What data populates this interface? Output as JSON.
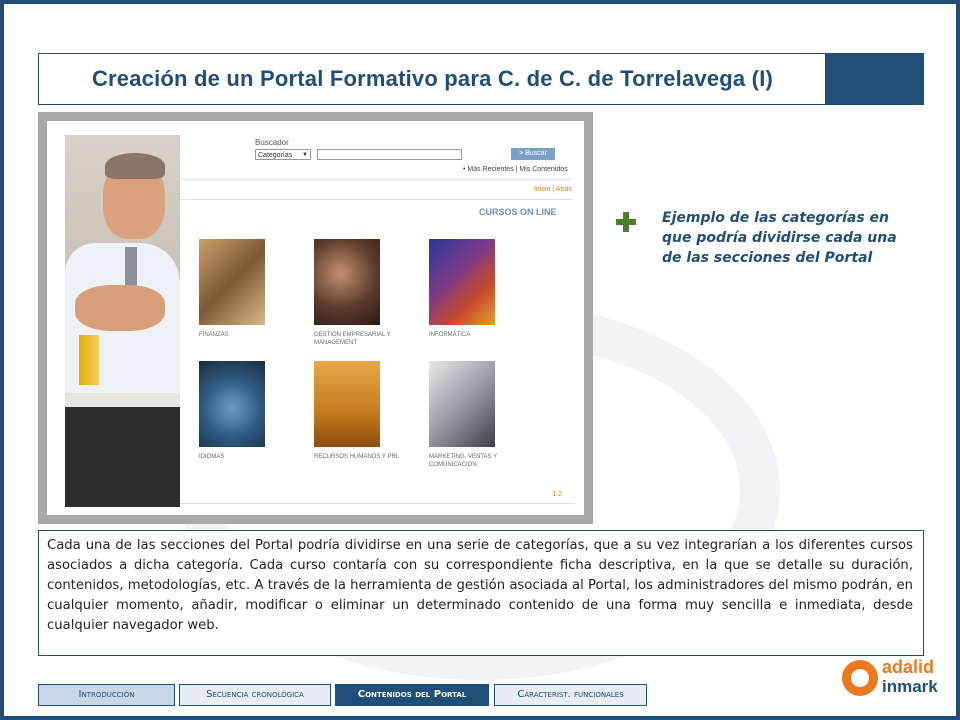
{
  "title": "Creación de un Portal Formativo para C. de C. de Torrelavega (I)",
  "screenshot": {
    "search_label": "Buscador",
    "search_select": "Categorías",
    "search_button": "> Buscar",
    "quick_links": "• Más Recientes | Mis Contenidos",
    "breadcrumb": "Inicio | Atrás",
    "section_heading": "CURSOS ON LINE",
    "pager": "1 2",
    "categories": [
      "FINANZAS",
      "GESTIÓN EMPRESARIAL Y MANAGEMENT",
      "INFORMÁTICA",
      "IDIOMAS",
      "RECURSOS HUMANOS Y PRL",
      "MARKETING, VENTAS Y COMUNICACIÓN"
    ]
  },
  "callout": {
    "icon": "plus-icon",
    "text": "Ejemplo de las categorías en que podría dividirse cada una de las secciones del Portal"
  },
  "description": "Cada una de las secciones del Portal podría dividirse en una serie de categorías, que a su vez integrarían a los diferentes cursos asociados a dicha categoría. Cada curso contaría con su correspondiente ficha descriptiva, en la que se detalle su duración, contenidos, metodologías, etc. A través de la herramienta de gestión asociada al Portal, los administradores del mismo podrán, en cualquier momento, añadir, modificar o eliminar un determinado contenido de una forma muy sencilla e inmediata, desde cualquier navegador web.",
  "nav": {
    "tabs": [
      {
        "label": "Introducción"
      },
      {
        "label": "Secuencia cronológica"
      },
      {
        "label": "Contenidos del Portal"
      },
      {
        "label": "Característ. funcionales"
      }
    ],
    "active_index": 2
  },
  "logo": {
    "word1": "adalid",
    "word2": "inmark"
  },
  "colors": {
    "primary": "#1f4e79",
    "accent": "#ec7a1c",
    "plus": "#4a7f2e"
  }
}
